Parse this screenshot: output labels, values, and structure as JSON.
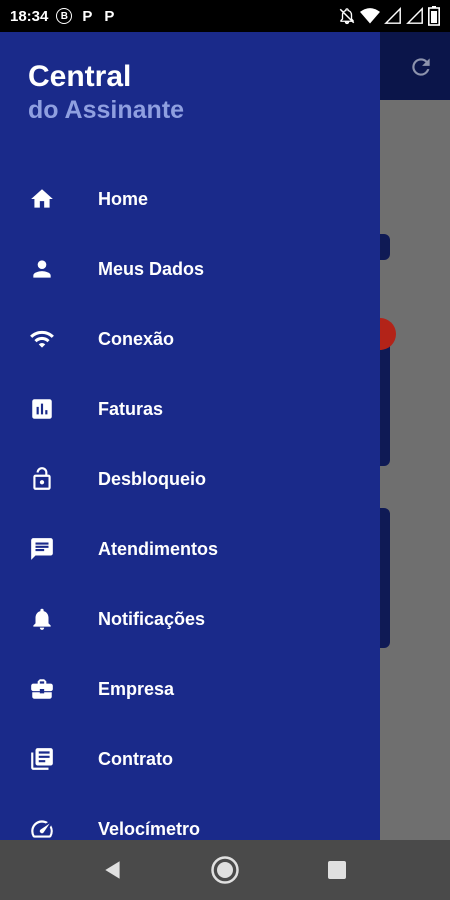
{
  "status_bar": {
    "time": "18:34",
    "badge_letter": "B",
    "notif_1": "P",
    "notif_2": "P",
    "icons": [
      "mute-icon",
      "wifi-icon",
      "signal-icon",
      "signal-icon",
      "battery-icon"
    ]
  },
  "drawer": {
    "title": "Central",
    "subtitle": "do Assinante",
    "items": [
      {
        "label": "Home",
        "icon": "home-icon"
      },
      {
        "label": "Meus Dados",
        "icon": "person-icon"
      },
      {
        "label": "Conexão",
        "icon": "wifi-icon"
      },
      {
        "label": "Faturas",
        "icon": "bar-chart-icon"
      },
      {
        "label": "Desbloqueio",
        "icon": "unlock-icon"
      },
      {
        "label": "Atendimentos",
        "icon": "chat-icon"
      },
      {
        "label": "Notificações",
        "icon": "bell-icon"
      },
      {
        "label": "Empresa",
        "icon": "briefcase-icon"
      },
      {
        "label": "Contrato",
        "icon": "document-icon"
      },
      {
        "label": "Velocímetro",
        "icon": "speedometer-icon"
      }
    ]
  },
  "colors": {
    "drawer_bg": "#1a2a8a",
    "subtitle": "#8f9fe0",
    "header_bg": "#0b154a",
    "badge": "#b32318"
  }
}
